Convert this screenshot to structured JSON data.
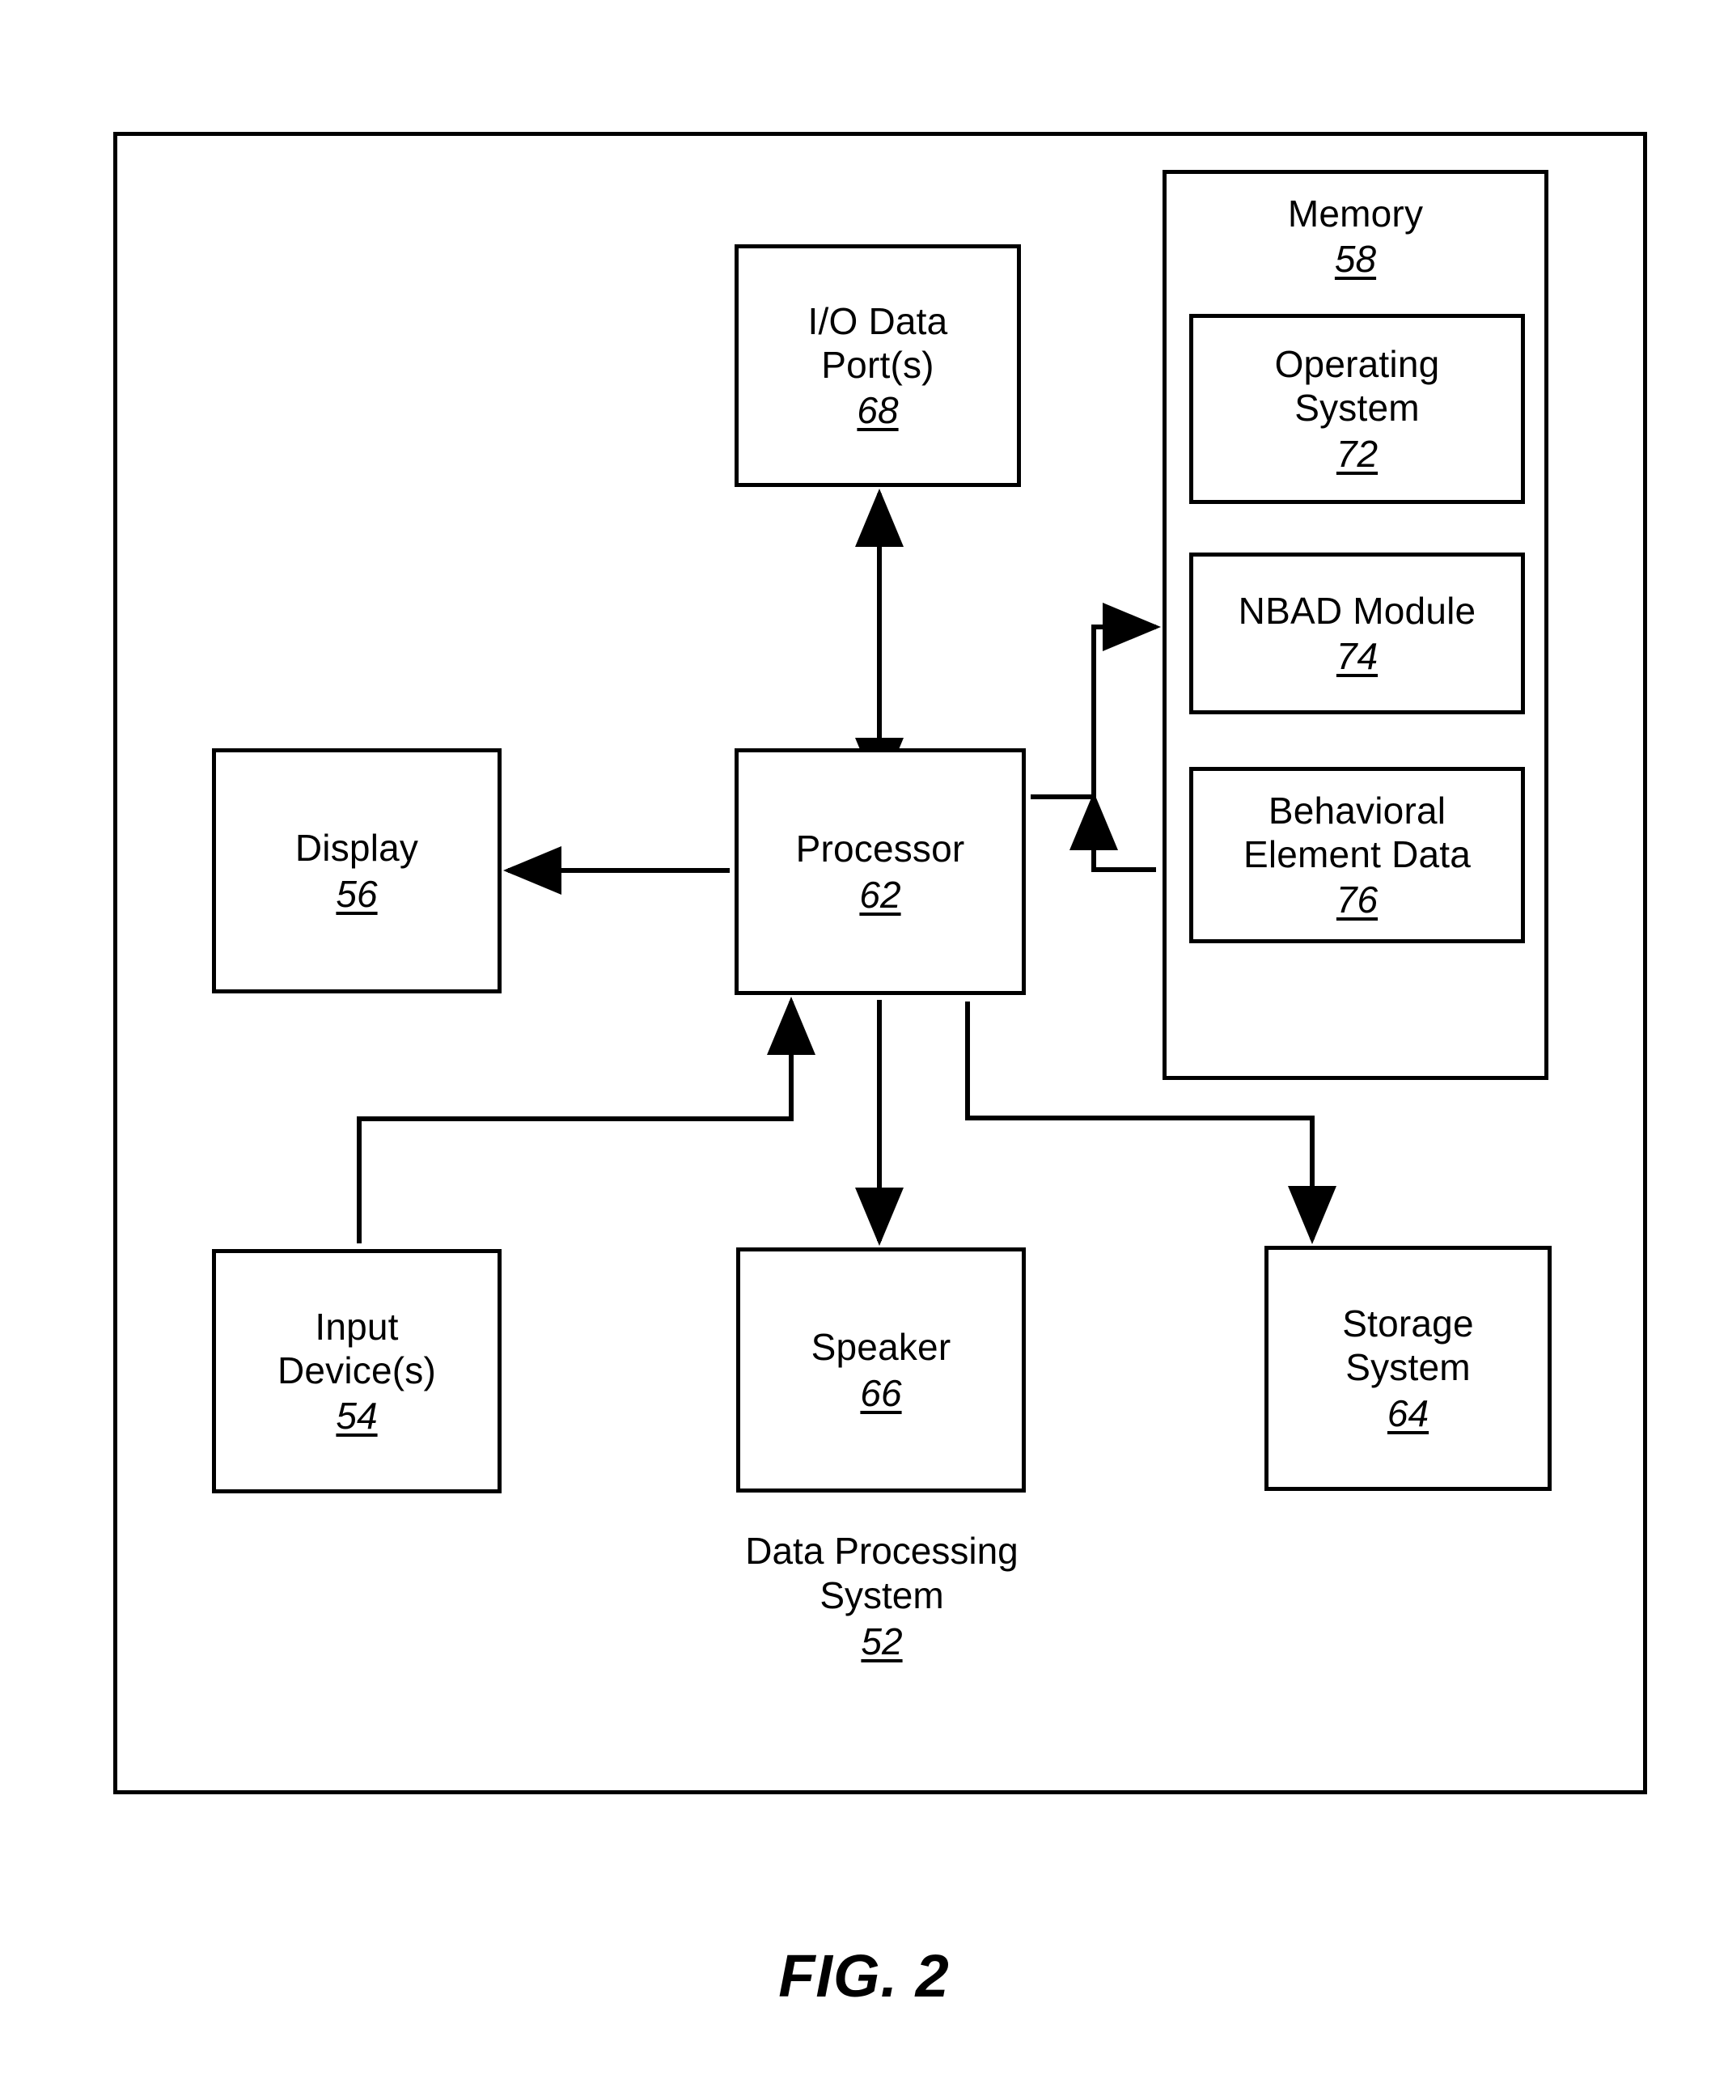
{
  "figure": {
    "caption": "FIG. 2",
    "system_caption": {
      "line1": "Data Processing",
      "line2": "System",
      "ref": "52"
    }
  },
  "nodes": {
    "io_ports": {
      "line1": "I/O Data",
      "line2": "Port(s)",
      "ref": "68"
    },
    "memory": {
      "line1": "Memory",
      "ref": "58"
    },
    "os": {
      "line1": "Operating",
      "line2": "System",
      "ref": "72"
    },
    "nbad": {
      "line1": "NBAD Module",
      "ref": "74"
    },
    "behavioral": {
      "line1": "Behavioral",
      "line2": "Element Data",
      "ref": "76"
    },
    "display": {
      "line1": "Display",
      "ref": "56"
    },
    "processor": {
      "line1": "Processor",
      "ref": "62"
    },
    "input": {
      "line1": "Input",
      "line2": "Device(s)",
      "ref": "54"
    },
    "speaker": {
      "line1": "Speaker",
      "ref": "66"
    },
    "storage": {
      "line1": "Storage",
      "line2": "System",
      "ref": "64"
    }
  },
  "connections": [
    {
      "from": "processor",
      "to": "io_ports",
      "style": "bidirectional"
    },
    {
      "from": "processor",
      "to": "display",
      "style": "arrow"
    },
    {
      "from": "processor",
      "to": "memory",
      "style": "arrow"
    },
    {
      "from": "memory",
      "to": "processor",
      "style": "arrow"
    },
    {
      "from": "input",
      "to": "processor",
      "style": "arrow"
    },
    {
      "from": "processor",
      "to": "speaker",
      "style": "arrow"
    },
    {
      "from": "processor",
      "to": "storage",
      "style": "arrow"
    }
  ],
  "colors": {
    "line": "#000000",
    "background": "#ffffff"
  }
}
